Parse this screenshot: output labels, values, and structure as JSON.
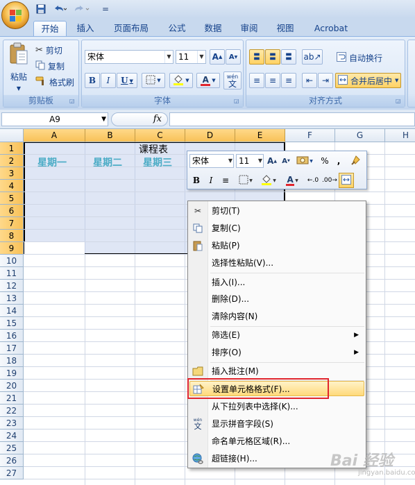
{
  "app": {
    "qat": {
      "save_icon": "save-icon",
      "undo_icon": "undo-icon",
      "redo_icon": "redo-icon",
      "customize": "="
    },
    "brand_color": "#15428b",
    "accent_color": "#f8c158"
  },
  "tabs": [
    {
      "label": "开始",
      "active": true
    },
    {
      "label": "插入"
    },
    {
      "label": "页面布局"
    },
    {
      "label": "公式"
    },
    {
      "label": "数据"
    },
    {
      "label": "审阅"
    },
    {
      "label": "视图"
    },
    {
      "label": "Acrobat"
    }
  ],
  "ribbon": {
    "clipboard": {
      "title": "剪贴板",
      "paste": "粘贴",
      "cut": "剪切",
      "copy": "复制",
      "format_painter": "格式刷"
    },
    "font": {
      "title": "字体",
      "font_name": "宋体",
      "font_size": "11",
      "grow": "A",
      "shrink": "A",
      "bold": "B",
      "italic": "I",
      "underline": "U",
      "phonetic": "wén"
    },
    "alignment": {
      "title": "对齐方式",
      "wrap_text": "自动换行",
      "merge_center": "合并后居中"
    }
  },
  "formula_bar": {
    "name_box": "A9",
    "fx": "fx",
    "formula": ""
  },
  "sheet": {
    "columns": [
      "A",
      "B",
      "C",
      "D",
      "E",
      "F",
      "G",
      "H"
    ],
    "rows": [
      "1",
      "2",
      "3",
      "4",
      "5",
      "6",
      "7",
      "8",
      "9",
      "10",
      "11",
      "12",
      "13",
      "14",
      "15",
      "16",
      "17",
      "18",
      "19",
      "20",
      "21",
      "22",
      "23",
      "24",
      "25",
      "26",
      "27"
    ],
    "title_cell": "课程表",
    "weekdays": [
      "星期一",
      "星期二",
      "星期三"
    ],
    "weekday_color": "#4bacc6"
  },
  "mini_toolbar": {
    "font_name": "宋体",
    "font_size": "11",
    "percent": "%",
    "comma": ",",
    "bold": "B",
    "italic": "I",
    "font_color_letter": "A"
  },
  "context_menu": {
    "items": [
      {
        "label": "剪切(T)",
        "icon": "scissors-icon"
      },
      {
        "label": "复制(C)",
        "icon": "copy-icon"
      },
      {
        "label": "粘贴(P)",
        "icon": "paste-icon"
      },
      {
        "label": "选择性粘贴(V)..."
      },
      {
        "label": "插入(I)..."
      },
      {
        "label": "删除(D)..."
      },
      {
        "label": "清除内容(N)"
      },
      {
        "label": "筛选(E)",
        "submenu": true
      },
      {
        "label": "排序(O)",
        "submenu": true
      },
      {
        "label": "插入批注(M)",
        "icon": "comment-icon"
      },
      {
        "label": "设置单元格格式(F)...",
        "icon": "format-cells-icon",
        "highlighted": true
      },
      {
        "label": "从下拉列表中选择(K)..."
      },
      {
        "label": "显示拼音字段(S)",
        "icon": "phonetic-icon"
      },
      {
        "label": "命名单元格区域(R)..."
      },
      {
        "label": "超链接(H)...",
        "icon": "hyperlink-icon"
      }
    ],
    "highlight_annotation_color": "#e0262e"
  },
  "watermark": {
    "text": "Bai 经验",
    "sub": "jingyan.baidu.com"
  }
}
